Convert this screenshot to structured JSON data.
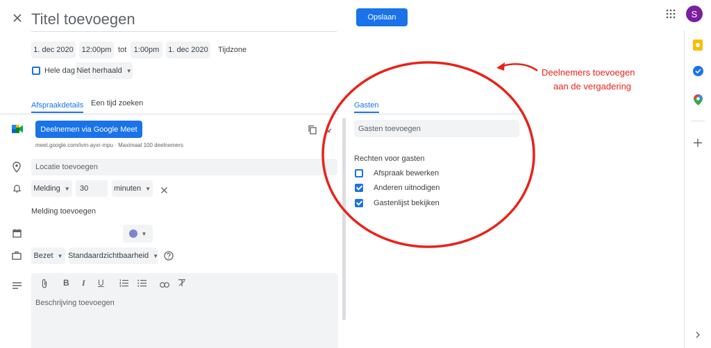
{
  "header": {
    "title_placeholder": "Titel toevoegen",
    "save_label": "Opslaan",
    "avatar_initial": "S"
  },
  "datetime": {
    "start_date": "1. dec 2020",
    "start_time": "12:00pm",
    "to_label": "tot",
    "end_time": "1:00pm",
    "end_date": "1. dec 2020",
    "timezone_label": "Tijdzone",
    "all_day_label": "Hele dag",
    "repeat_label": "Niet herhaald"
  },
  "tabs": {
    "details": "Afspraakdetails",
    "find_time": "Een tijd zoeken"
  },
  "meet": {
    "join_label": "Deelnemen via Google Meet",
    "info": "meet.google.com/ivm-ayxr-mpu · Maximaal 100 deelnemers"
  },
  "location": {
    "placeholder": "Locatie toevoegen"
  },
  "notification": {
    "type": "Melding",
    "value": "30",
    "unit": "minuten",
    "add_label": "Melding toevoegen"
  },
  "availability": {
    "status": "Bezet",
    "visibility": "Standaardzichtbaarheid"
  },
  "description": {
    "placeholder": "Beschrijving toevoegen"
  },
  "guests": {
    "tab_label": "Gasten",
    "input_placeholder": "Gasten toevoegen",
    "permissions_title": "Rechten voor gasten",
    "permissions": [
      {
        "label": "Afspraak bewerken",
        "checked": false
      },
      {
        "label": "Anderen uitnodigen",
        "checked": true
      },
      {
        "label": "Gastenlijst bekijken",
        "checked": true
      }
    ]
  },
  "annotation": {
    "line1": "Deelnemers toevoegen",
    "line2": "aan de vergadering",
    "color": "#e8221a"
  },
  "colors": {
    "accent": "#1a73e8",
    "event_color": "#7986cb"
  }
}
